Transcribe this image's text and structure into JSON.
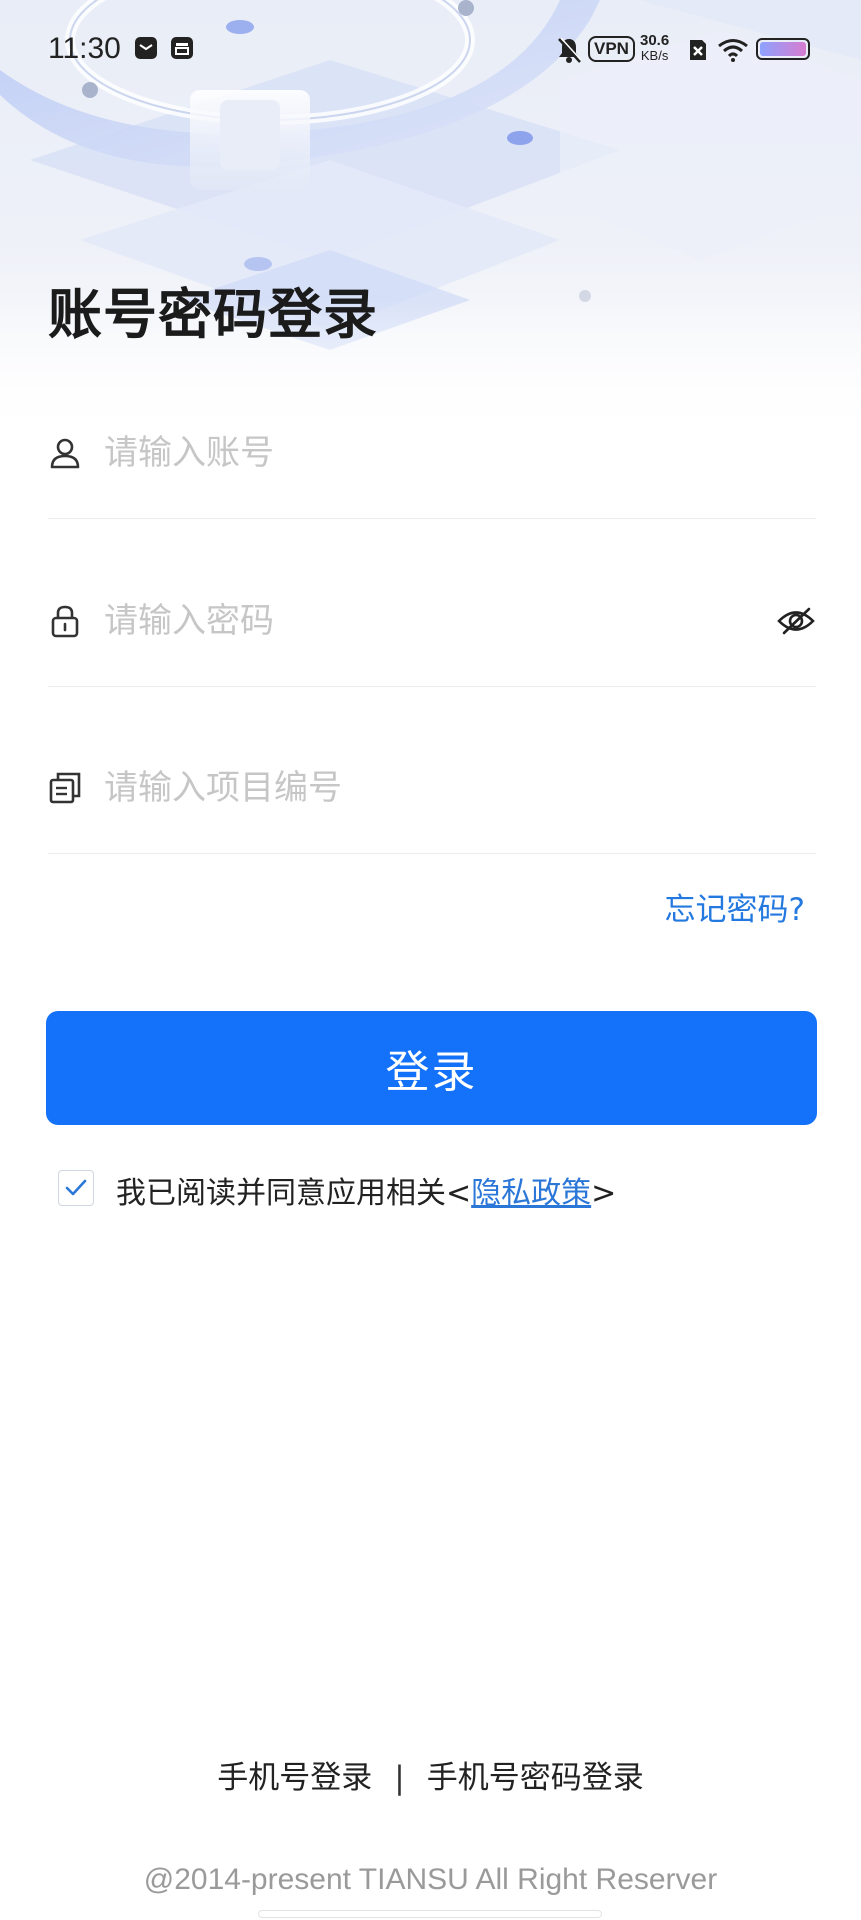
{
  "status_bar": {
    "time": "11:30",
    "vpn_label": "VPN",
    "net_speed_value": "30.6",
    "net_speed_unit": "KB/s",
    "icons": [
      "mail-notification-icon",
      "calendar-notification-icon",
      "bell-muted-icon",
      "sim-disabled-icon",
      "wifi-icon",
      "battery-icon"
    ]
  },
  "page": {
    "title": "账号密码登录"
  },
  "form": {
    "account_placeholder": "请输入账号",
    "password_placeholder": "请输入密码",
    "project_placeholder": "请输入项目编号",
    "forgot_label": "忘记密码?",
    "login_label": "登录"
  },
  "agreement": {
    "checked": true,
    "prefix": "我已阅读并同意应用相关<",
    "link": "隐私政策",
    "suffix": ">"
  },
  "alternatives": {
    "phone_login": "手机号登录",
    "separator": "|",
    "phone_password_login": "手机号密码登录"
  },
  "footer": {
    "copyright": "@2014-present TIANSU All Right Reserver"
  },
  "colors": {
    "primary": "#1472fa",
    "link": "#2379e0"
  }
}
